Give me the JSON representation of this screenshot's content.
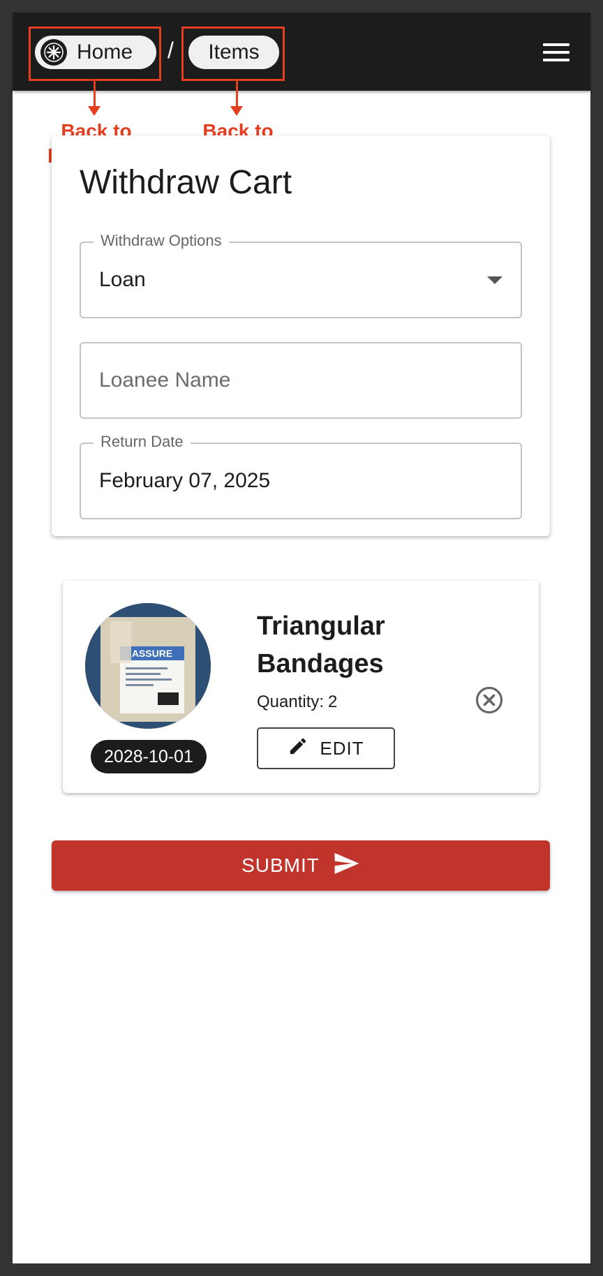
{
  "breadcrumb": {
    "home_label": "Home",
    "separator": "/",
    "items_label": "Items"
  },
  "annotations": {
    "home_note": "Back to\nhomepage",
    "items_note": "Back to\nitems index",
    "color": "#e53e1f"
  },
  "form": {
    "title": "Withdraw Cart",
    "withdraw_options_label": "Withdraw Options",
    "withdraw_options_value": "Loan",
    "loanee_placeholder": "Loanee Name",
    "return_date_label": "Return Date",
    "return_date_value": "February 07, 2025"
  },
  "cart_item": {
    "name": "Triangular Bandages",
    "quantity_label": "Quantity:",
    "quantity_value": "2",
    "expiry_date": "2028-10-01",
    "edit_label": "EDIT",
    "image_text": "ASSURE"
  },
  "submit_label": "SUBMIT",
  "colors": {
    "topbar": "#1c1c1c",
    "submit": "#c1342c"
  }
}
